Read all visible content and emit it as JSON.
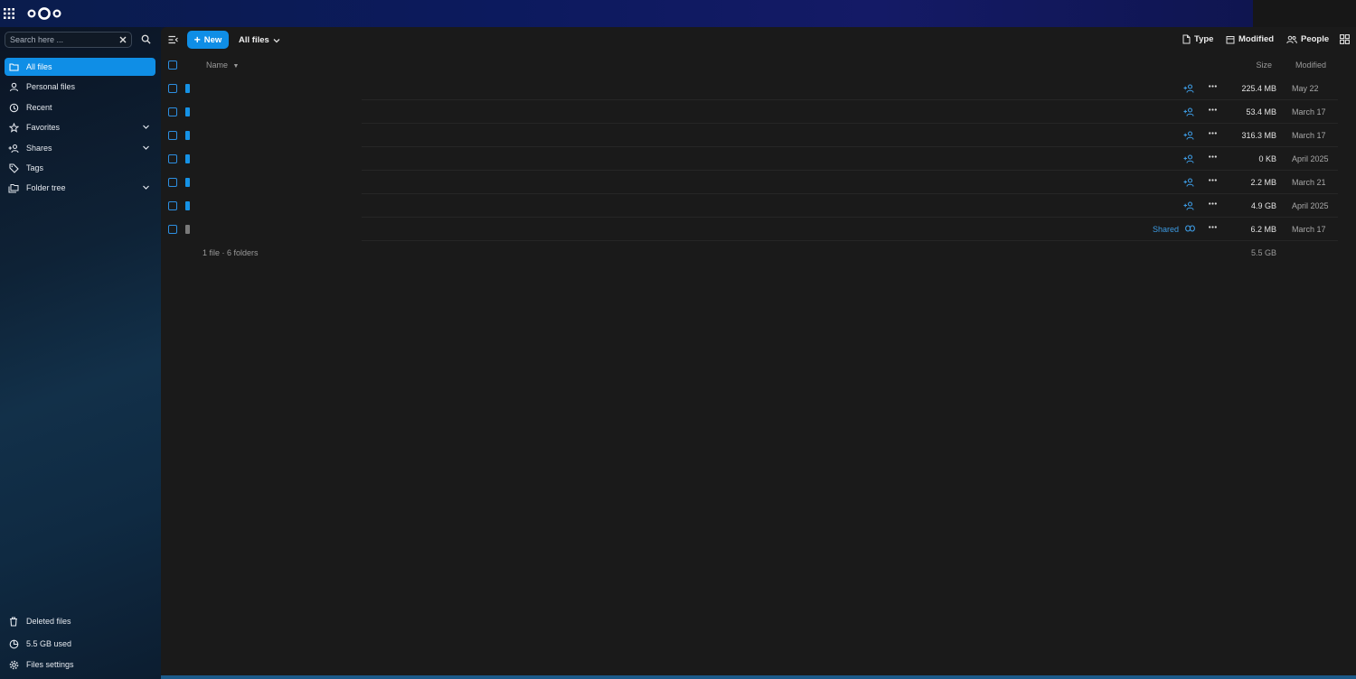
{
  "topbar": {
    "apps_icon": "apps-grid-icon",
    "logo": "nextcloud-logo"
  },
  "sidebar": {
    "search": {
      "placeholder": "Search here ..."
    },
    "items": [
      {
        "label": "All files",
        "icon": "folder-icon",
        "active": true
      },
      {
        "label": "Personal files",
        "icon": "person-icon"
      },
      {
        "label": "Recent",
        "icon": "history-icon"
      },
      {
        "label": "Favorites",
        "icon": "star-icon",
        "expandable": true
      },
      {
        "label": "Shares",
        "icon": "share-icon",
        "expandable": true
      },
      {
        "label": "Tags",
        "icon": "tag-icon"
      },
      {
        "label": "Folder tree",
        "icon": "folder-multiple-icon",
        "expandable": true
      }
    ],
    "footer": [
      {
        "label": "Deleted files",
        "icon": "trash-icon"
      },
      {
        "label": "5.5 GB used",
        "icon": "storage-pie-icon"
      },
      {
        "label": "Files settings",
        "icon": "gear-icon"
      }
    ]
  },
  "toolbar": {
    "new_label": "New",
    "breadcrumb": "All files",
    "filters": {
      "type": "Type",
      "modified": "Modified",
      "people": "People"
    }
  },
  "table": {
    "columns": {
      "name": "Name",
      "size": "Size",
      "modified": "Modified"
    },
    "rows": [
      {
        "kind": "folder",
        "size": "225.4 MB",
        "modified": "May 22"
      },
      {
        "kind": "folder",
        "size": "53.4 MB",
        "modified": "March 17"
      },
      {
        "kind": "folder",
        "size": "316.3 MB",
        "modified": "March 17"
      },
      {
        "kind": "folder",
        "size": "0 KB",
        "modified": "April 2025"
      },
      {
        "kind": "folder",
        "size": "2.2 MB",
        "modified": "March 21"
      },
      {
        "kind": "folder",
        "size": "4.9 GB",
        "modified": "April 2025"
      },
      {
        "kind": "file",
        "size": "6.2 MB",
        "modified": "March 17",
        "shared_label": "Shared"
      }
    ],
    "summary": {
      "count": "1 file · 6 folders",
      "total": "5.5 GB"
    }
  },
  "colors": {
    "accent": "#0f8ee6",
    "background": "#1a1a1a"
  }
}
